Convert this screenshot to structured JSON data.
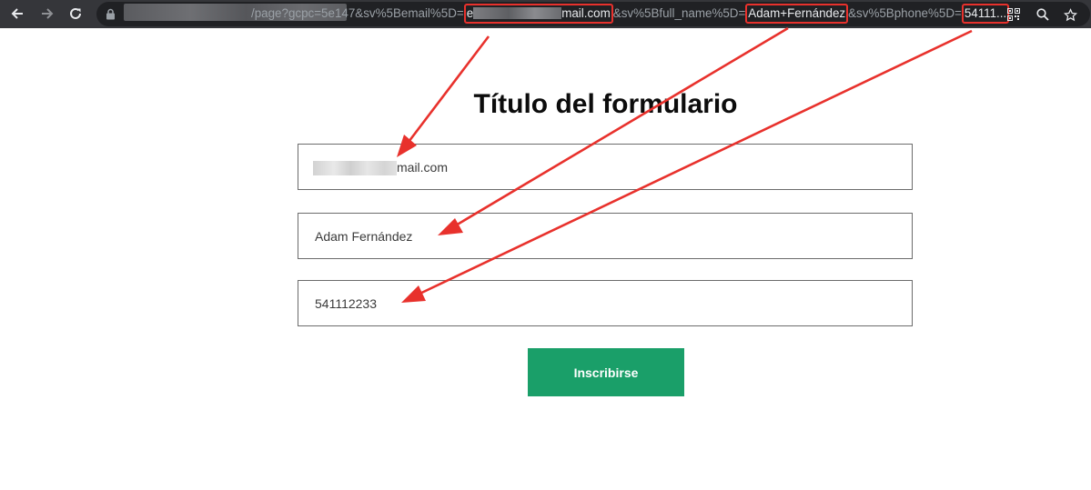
{
  "browser": {
    "url_prefix": "/page?gcpc=5e147&sv%5Bemail%5D=",
    "url_email_start": "e",
    "url_email_domain": "mail.com",
    "url_mid_1": "&sv%5Bfull_name%5D=",
    "url_name": "Adam+Fernández",
    "url_mid_2": "&sv%5Bphone%5D=",
    "url_phone": "54111..."
  },
  "form": {
    "title": "Título del formulario",
    "email_suffix": "mail.com",
    "full_name_value": "Adam Fernández",
    "phone_value": "541112233",
    "submit_label": "Inscribirse"
  },
  "colors": {
    "accent": "#1a9f69",
    "annotation": "#e8312c",
    "toolbar": "#35363a"
  },
  "icons": [
    "back-arrow-icon",
    "forward-arrow-icon",
    "reload-icon",
    "lock-icon",
    "qr-code-icon",
    "zoom-icon",
    "star-icon"
  ]
}
